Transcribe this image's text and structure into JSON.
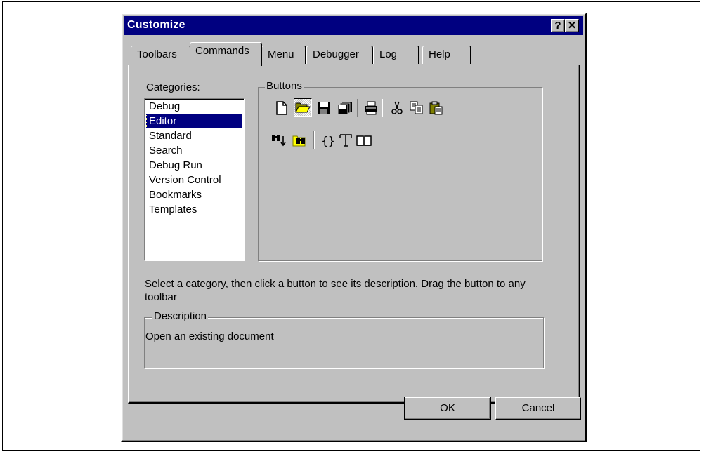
{
  "window": {
    "title": "Customize",
    "help_label": "?",
    "close_label": "✕"
  },
  "tabs": [
    {
      "label": "Toolbars"
    },
    {
      "label": "Commands"
    },
    {
      "label": "Menu"
    },
    {
      "label": "Debugger"
    },
    {
      "label": "Log"
    },
    {
      "label": "Help"
    }
  ],
  "categories": {
    "label": "Categories:",
    "items": [
      "Debug",
      "Editor",
      "Standard",
      "Search",
      "Debug Run",
      "Version Control",
      "Bookmarks",
      "Templates"
    ],
    "selected": "Editor"
  },
  "buttons_group": {
    "label": "Buttons",
    "icons": [
      "new-document-icon",
      "open-folder-icon",
      "save-icon",
      "save-all-icon",
      "print-icon",
      "cut-icon",
      "copy-icon",
      "paste-icon",
      "find-icon",
      "find-in-files-icon",
      "braces-icon",
      "font-icon",
      "book-icon"
    ],
    "pressed": "open-folder-icon"
  },
  "hint_text": "Select a category, then click a button to see its description. Drag the button to any toolbar",
  "description": {
    "label": "Description",
    "text": "Open an existing document"
  },
  "footer": {
    "ok_label": "OK",
    "cancel_label": "Cancel"
  }
}
